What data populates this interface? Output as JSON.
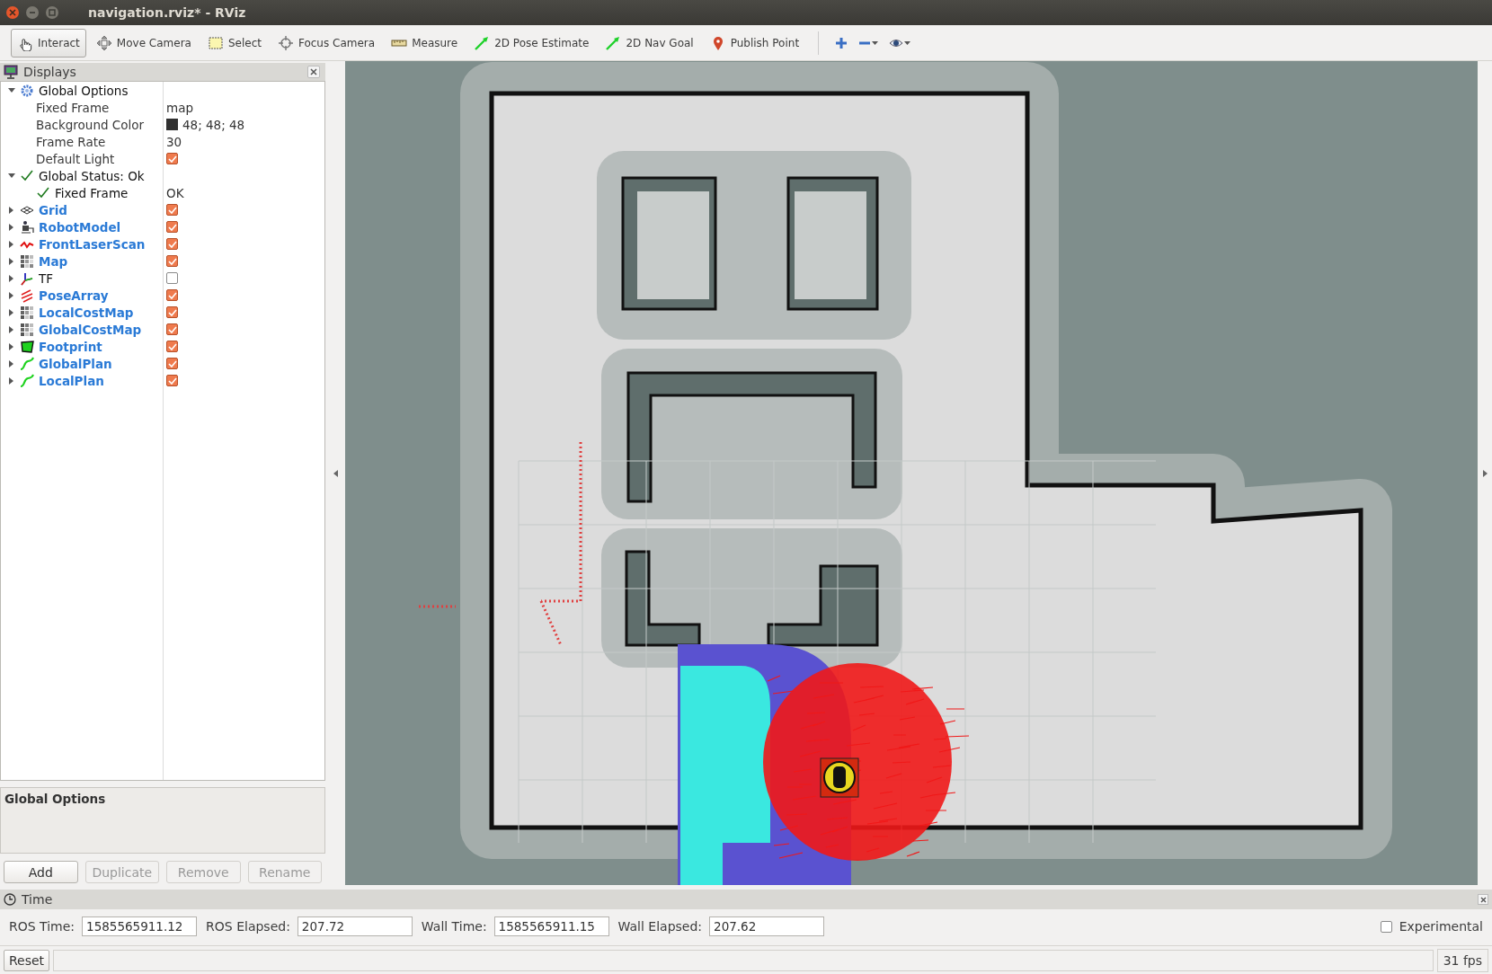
{
  "window": {
    "title": "navigation.rviz* - RViz"
  },
  "toolbar": {
    "tools": [
      {
        "label": "Interact",
        "selected": true
      },
      {
        "label": "Move Camera",
        "selected": false
      },
      {
        "label": "Select",
        "selected": false
      },
      {
        "label": "Focus Camera",
        "selected": false
      },
      {
        "label": "Measure",
        "selected": false
      },
      {
        "label": "2D Pose Estimate",
        "selected": false
      },
      {
        "label": "2D Nav Goal",
        "selected": false
      },
      {
        "label": "Publish Point",
        "selected": false
      }
    ]
  },
  "displays": {
    "title": "Displays",
    "items": [
      {
        "label": "Global Options",
        "kind": "options",
        "expanded": true,
        "children": [
          {
            "label": "Fixed Frame",
            "kind": "property",
            "value": "map"
          },
          {
            "label": "Background Color",
            "kind": "property",
            "value": "48; 48; 48",
            "color": "#303030"
          },
          {
            "label": "Frame Rate",
            "kind": "property",
            "value": "30"
          },
          {
            "label": "Default Light",
            "kind": "property",
            "checked": true
          }
        ]
      },
      {
        "label": "Global Status: Ok",
        "kind": "status",
        "expanded": true,
        "children": [
          {
            "label": "Fixed Frame",
            "kind": "status",
            "value": "OK"
          }
        ]
      },
      {
        "label": "Grid",
        "kind": "grid",
        "expanded": false,
        "checked": true
      },
      {
        "label": "RobotModel",
        "kind": "robot",
        "expanded": false,
        "checked": true
      },
      {
        "label": "FrontLaserScan",
        "kind": "laser",
        "expanded": false,
        "checked": true
      },
      {
        "label": "Map",
        "kind": "map",
        "expanded": false,
        "checked": true
      },
      {
        "label": "TF",
        "kind": "tf",
        "expanded": false,
        "checked": false
      },
      {
        "label": "PoseArray",
        "kind": "poses",
        "expanded": false,
        "checked": true
      },
      {
        "label": "LocalCostMap",
        "kind": "map",
        "expanded": false,
        "checked": true
      },
      {
        "label": "GlobalCostMap",
        "kind": "map",
        "expanded": false,
        "checked": true
      },
      {
        "label": "Footprint",
        "kind": "footprint",
        "expanded": false,
        "checked": true
      },
      {
        "label": "GlobalPlan",
        "kind": "path",
        "expanded": false,
        "checked": true
      },
      {
        "label": "LocalPlan",
        "kind": "path",
        "expanded": false,
        "checked": true
      }
    ],
    "description": "Global Options",
    "buttons": [
      {
        "label": "Add",
        "disabled": false
      },
      {
        "label": "Duplicate",
        "disabled": true
      },
      {
        "label": "Remove",
        "disabled": true
      },
      {
        "label": "Rename",
        "disabled": true
      }
    ]
  },
  "time": {
    "title": "Time",
    "fields": [
      {
        "label": "ROS Time:",
        "value": "1585565911.12"
      },
      {
        "label": "ROS Elapsed:",
        "value": "207.72"
      },
      {
        "label": "Wall Time:",
        "value": "1585565911.15"
      },
      {
        "label": "Wall Elapsed:",
        "value": "207.62"
      }
    ],
    "experimental": {
      "label": "Experimental",
      "checked": false
    }
  },
  "status_bar": {
    "reset": "Reset",
    "fps": "31 fps"
  }
}
